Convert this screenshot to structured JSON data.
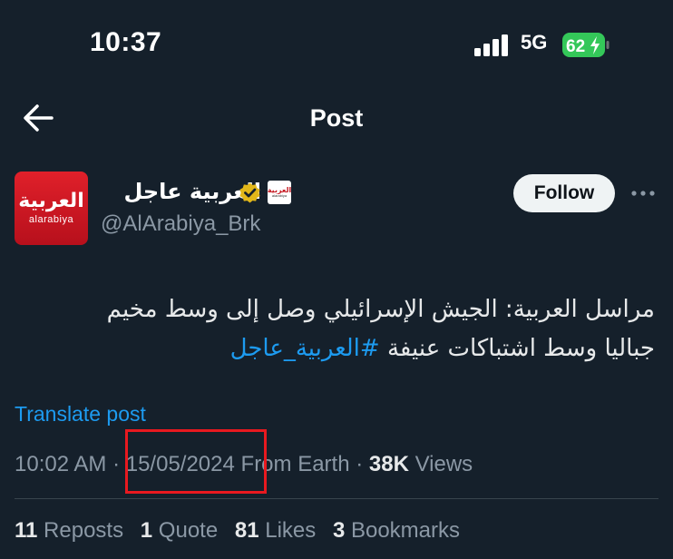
{
  "status_bar": {
    "time": "10:37",
    "network": "5G",
    "battery": "62"
  },
  "nav": {
    "title": "Post"
  },
  "author": {
    "display_name": "العربية عاجل",
    "handle": "@AlArabiya_Brk",
    "avatar_logo_text": "العربية",
    "avatar_logo_sub": "alarabiya",
    "affiliate_logo_text": "العربية",
    "affiliate_logo_sub": "alarabiya",
    "follow_label": "Follow"
  },
  "tweet": {
    "line1": "مراسل العربية: الجيش الإسرائيلي وصل إلى وسط مخيم",
    "line2_text": "جباليا وسط اشتباكات عنيفة ",
    "hashtag": "#العربية_عاجل",
    "translate_label": "Translate post"
  },
  "meta": {
    "time": "10:02 AM",
    "date": "15/05/2024",
    "source": "From Earth",
    "views_count": "38K",
    "views_label": "Views"
  },
  "stats": {
    "reposts_count": "11",
    "reposts_label": "Reposts",
    "quotes_count": "1",
    "quotes_label": "Quote",
    "likes_count": "81",
    "likes_label": "Likes",
    "bookmarks_count": "3",
    "bookmarks_label": "Bookmarks"
  },
  "colors": {
    "background": "#15202b",
    "accent": "#1d9bf0",
    "highlight_box": "#e8191f",
    "verified": "#e2b719",
    "brand_red": "#d8181f"
  },
  "icons": [
    "signal-icon",
    "battery-icon",
    "back-arrow-icon",
    "verified-badge-icon",
    "more-icon"
  ]
}
